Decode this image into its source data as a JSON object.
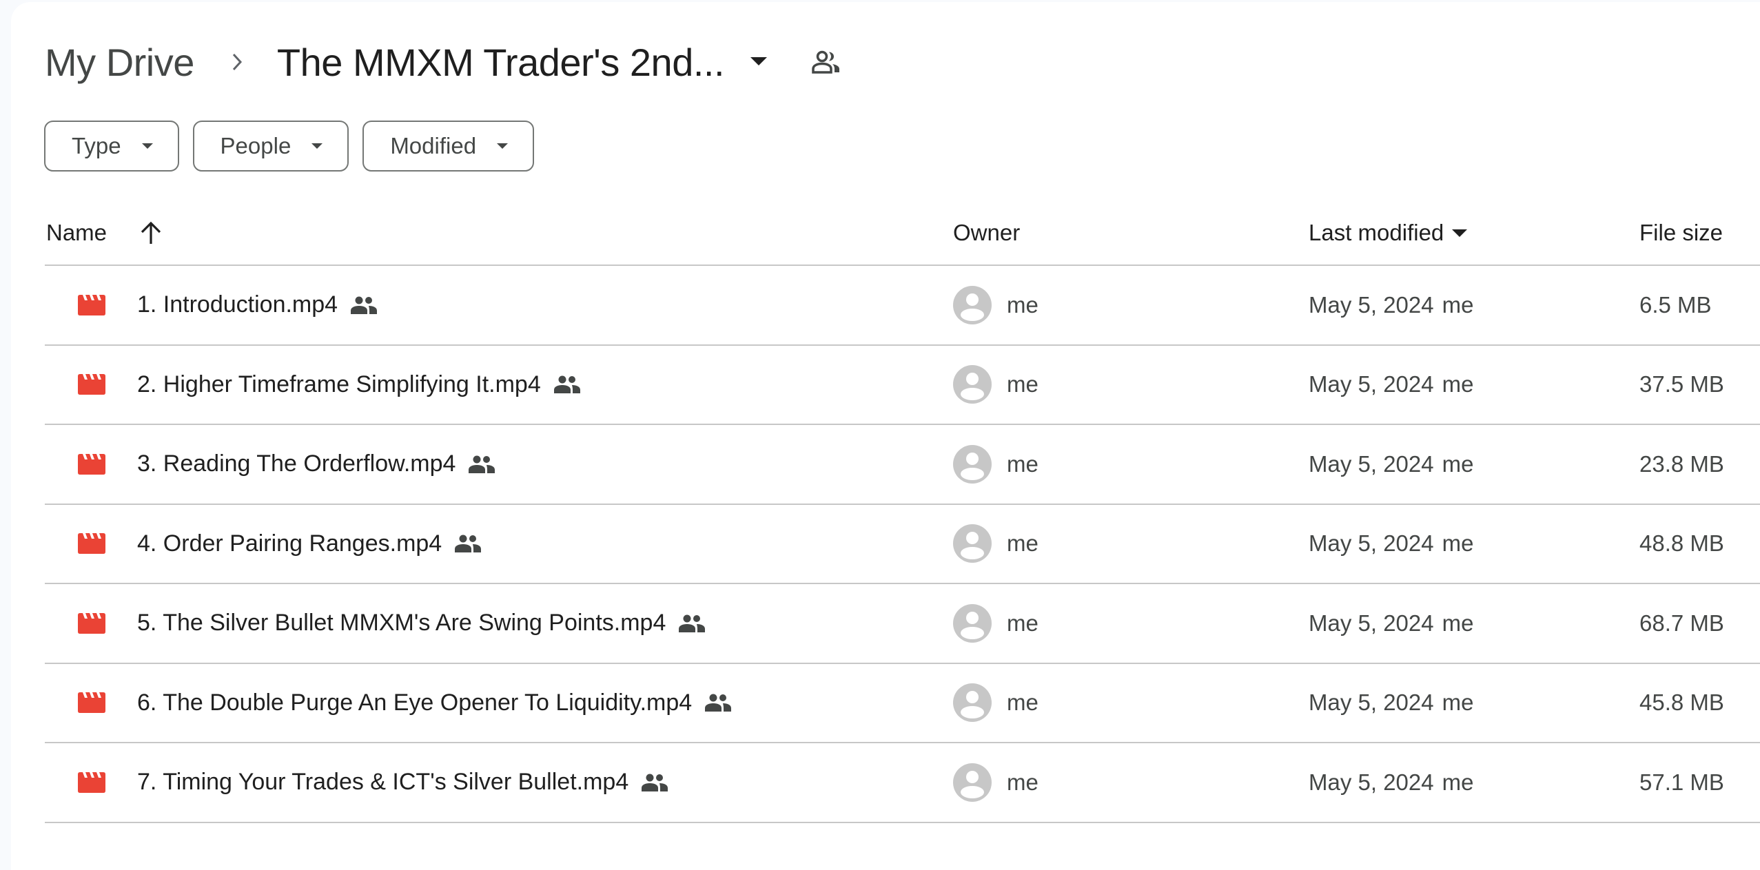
{
  "breadcrumb": {
    "root": "My Drive",
    "current": "The MMXM Trader's 2nd...",
    "icons": {
      "separator": "chevron-right-icon",
      "dropdown": "arrow-drop-down-icon",
      "shared": "shared-folder-people-icon"
    }
  },
  "filters": [
    {
      "label": "Type"
    },
    {
      "label": "People"
    },
    {
      "label": "Modified"
    }
  ],
  "table": {
    "columns": {
      "name": "Name",
      "owner": "Owner",
      "last_modified": "Last modified",
      "file_size": "File size"
    },
    "sort": {
      "name_icon": "arrow-upward-icon",
      "last_modified_icon": "arrow-drop-down-icon"
    },
    "rows": [
      {
        "name": "1. Introduction.mp4",
        "owner": "me",
        "modified_date": "May 5, 2024",
        "modified_by": "me",
        "size": "6.5 MB"
      },
      {
        "name": "2. Higher Timeframe Simplifying It.mp4",
        "owner": "me",
        "modified_date": "May 5, 2024",
        "modified_by": "me",
        "size": "37.5 MB"
      },
      {
        "name": "3. Reading The Orderflow.mp4",
        "owner": "me",
        "modified_date": "May 5, 2024",
        "modified_by": "me",
        "size": "23.8 MB"
      },
      {
        "name": "4. Order Pairing Ranges.mp4",
        "owner": "me",
        "modified_date": "May 5, 2024",
        "modified_by": "me",
        "size": "48.8 MB"
      },
      {
        "name": "5. The Silver Bullet MMXM's Are Swing Points.mp4",
        "owner": "me",
        "modified_date": "May 5, 2024",
        "modified_by": "me",
        "size": "68.7 MB"
      },
      {
        "name": "6. The Double Purge An Eye Opener To Liquidity.mp4",
        "owner": "me",
        "modified_date": "May 5, 2024",
        "modified_by": "me",
        "size": "45.8 MB"
      },
      {
        "name": "7. Timing Your Trades & ICT's Silver Bullet.mp4",
        "owner": "me",
        "modified_date": "May 5, 2024",
        "modified_by": "me",
        "size": "57.1 MB"
      }
    ]
  },
  "colors": {
    "video_icon": "#ea4335",
    "divider": "#c7c7c7",
    "avatar_bg": "#c7c7c7",
    "page_bg": "#f8fafd"
  }
}
